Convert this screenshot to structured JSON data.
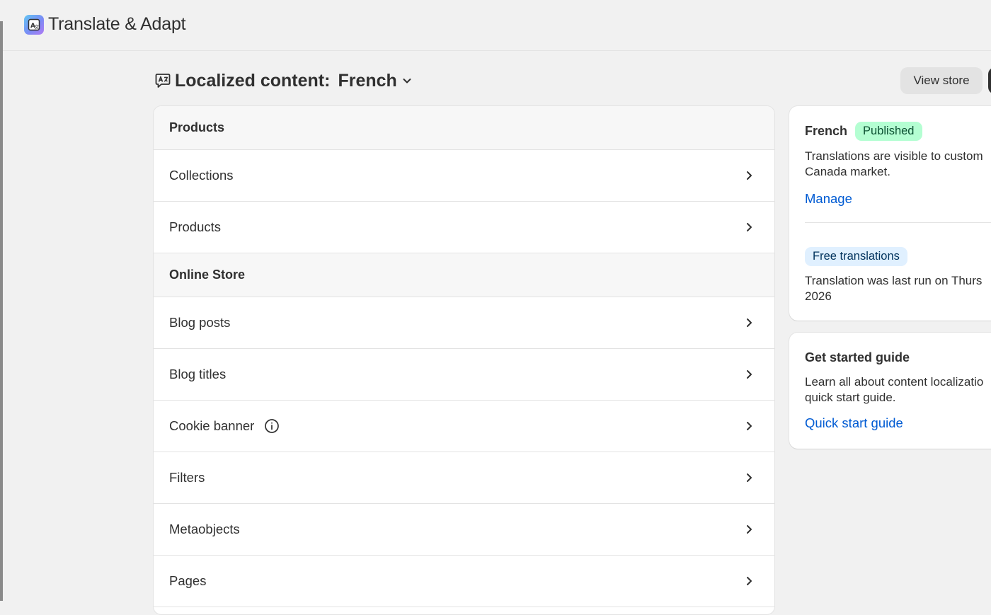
{
  "app": {
    "title": "Translate & Adapt",
    "logo_icon": "translate-app-icon"
  },
  "page": {
    "heading_label": "Localized content:",
    "heading_language": "French",
    "heading_icon": "translate-bubble-icon",
    "view_store_label": "View store"
  },
  "sections": [
    {
      "title": "Products",
      "items": [
        {
          "label": "Collections"
        },
        {
          "label": "Products"
        }
      ]
    },
    {
      "title": "Online Store",
      "items": [
        {
          "label": "Blog posts"
        },
        {
          "label": "Blog titles"
        },
        {
          "label": "Cookie banner",
          "icon": "info-icon"
        },
        {
          "label": "Filters"
        },
        {
          "label": "Metaobjects"
        },
        {
          "label": "Pages"
        }
      ]
    }
  ],
  "status_card": {
    "language": "French",
    "badge": "Published",
    "description_line1": "Translations are visible to custom",
    "description_line2": "Canada market.",
    "manage_label": "Manage",
    "free_badge": "Free translations",
    "last_run_line1": "Translation was last run on Thurs",
    "last_run_line2": "2026"
  },
  "guide_card": {
    "title": "Get started guide",
    "description_line1": "Learn all about content localizatio",
    "description_line2": "quick start guide.",
    "link_label": "Quick start guide"
  },
  "colors": {
    "background": "#f1f1f1",
    "link": "#005bd3",
    "published_badge_bg": "#b4fed2",
    "free_badge_bg": "#e0f0ff"
  }
}
